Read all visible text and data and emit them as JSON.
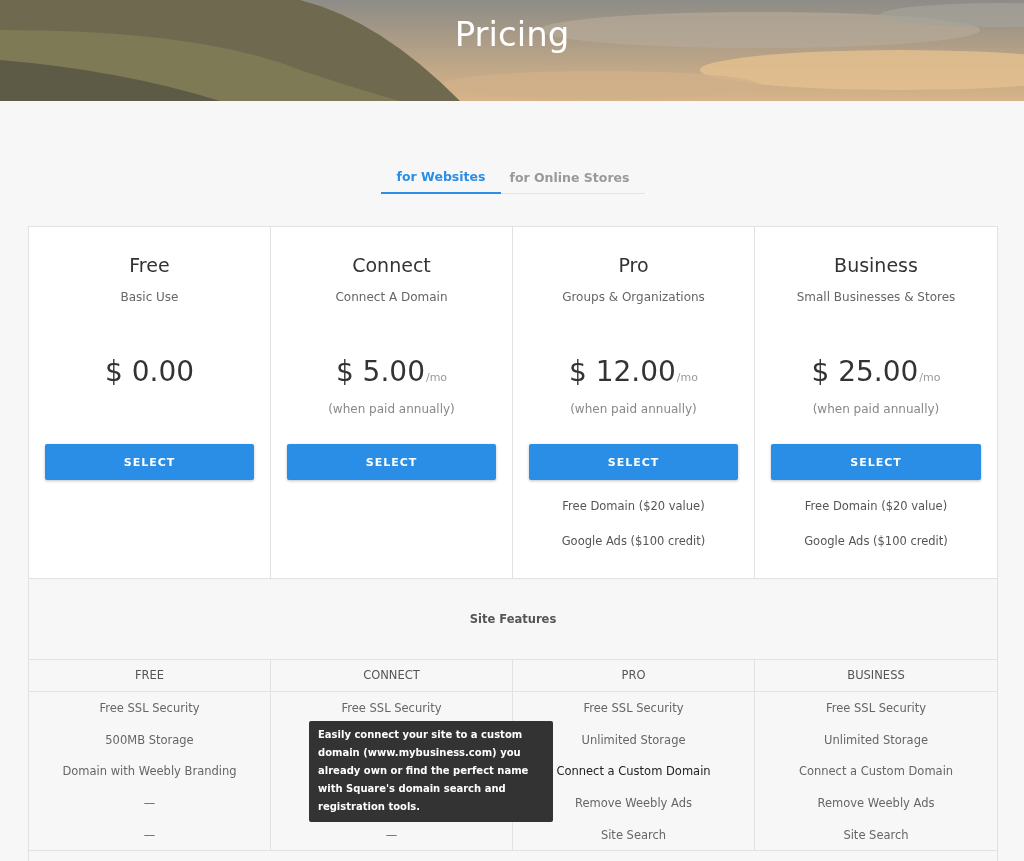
{
  "hero": {
    "title": "Pricing",
    "kind": "picture"
  },
  "tabs": [
    {
      "label": "for Websites",
      "selected": true
    },
    {
      "label": "for Online Stores",
      "selected": false
    }
  ],
  "plans": [
    {
      "name": "Free",
      "subtitle": "Basic Use",
      "price": "$ 0.00",
      "button": "SELECT"
    },
    {
      "name": "Connect",
      "subtitle": "Connect A Domain",
      "price": "$ 5.00",
      "period": "/mo",
      "note": "(when paid annually)",
      "button": "SELECT"
    },
    {
      "name": "Pro",
      "subtitle": "Groups & Organizations",
      "price": "$ 12.00",
      "period": "/mo",
      "note": "(when paid annually)",
      "button": "SELECT",
      "perks": [
        "Free Domain ($20 value)",
        "Google Ads ($100 credit)"
      ]
    },
    {
      "name": "Business",
      "subtitle": "Small Businesses & Stores",
      "price": "$ 25.00",
      "period": "/mo",
      "note": "(when paid annually)",
      "button": "SELECT",
      "perks": [
        "Free Domain ($20 value)",
        "Google Ads ($100 credit)"
      ]
    }
  ],
  "features": {
    "title": "Site Features",
    "columns": [
      "FREE",
      "CONNECT",
      "PRO",
      "BUSINESS"
    ],
    "rows": [
      [
        {
          "text": "Free SSL Security",
          "hovered": false
        },
        {
          "text": "Free SSL Security",
          "hovered": false
        },
        {
          "text": "Free SSL Security",
          "hovered": false
        },
        {
          "text": "Free SSL Security",
          "hovered": false
        }
      ],
      [
        {
          "text": "500MB Storage",
          "hovered": false
        },
        null,
        {
          "text": "Unlimited Storage",
          "hovered": false
        },
        {
          "text": "Unlimited Storage",
          "hovered": false
        }
      ],
      [
        {
          "text": "Domain with Weebly Branding",
          "hovered": false
        },
        null,
        {
          "text": "Connect a Custom Domain",
          "hovered": true
        },
        {
          "text": "Connect a Custom Domain",
          "hovered": false
        }
      ],
      [
        {
          "text": "—",
          "hovered": false
        },
        null,
        {
          "text": "Remove Weebly Ads",
          "hovered": false
        },
        {
          "text": "Remove Weebly Ads",
          "hovered": false
        }
      ],
      [
        {
          "text": "—",
          "hovered": false
        },
        {
          "text": "—",
          "hovered": false
        },
        {
          "text": "Site Search",
          "hovered": false
        },
        {
          "text": "Site Search",
          "hovered": false
        }
      ]
    ]
  },
  "tooltip": {
    "text": "Easily connect your site to a custom domain (www.mybusiness.com) you already own or find the perfect name with Square's domain search and registration tools."
  }
}
